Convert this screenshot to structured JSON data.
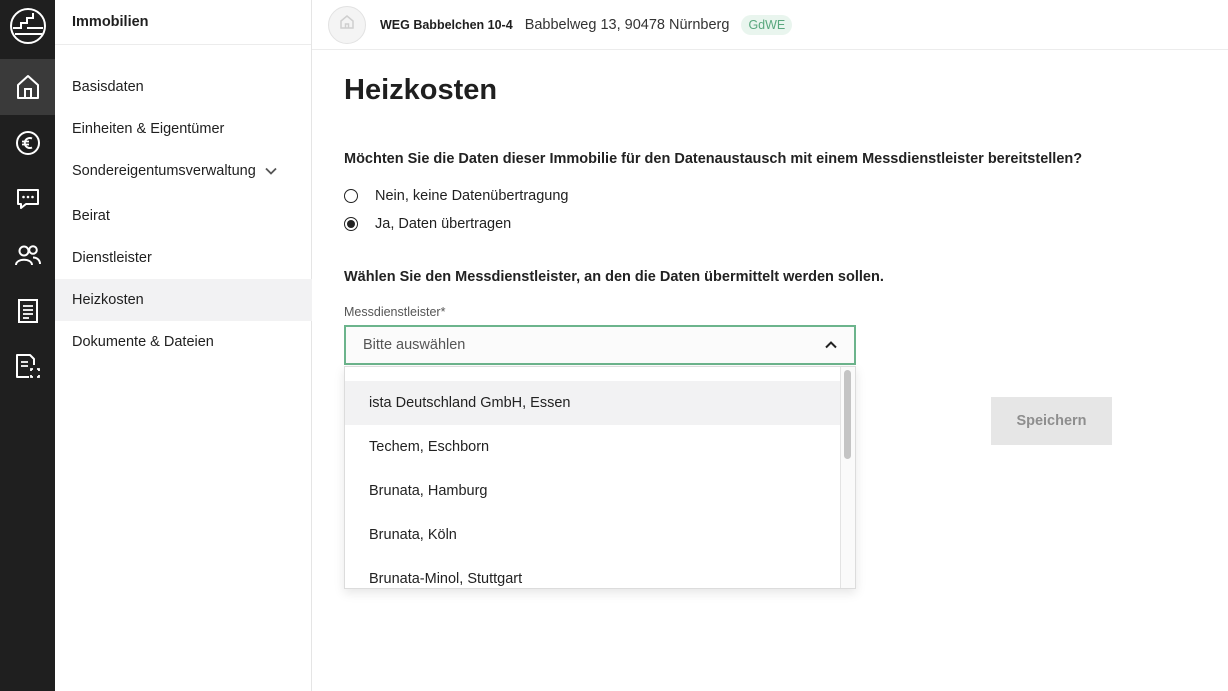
{
  "rail": {
    "items": [
      {
        "icon": "home-icon",
        "active": true
      },
      {
        "icon": "euro-icon",
        "active": false
      },
      {
        "icon": "chat-icon",
        "active": false
      },
      {
        "icon": "users-icon",
        "active": false
      },
      {
        "icon": "document-list-icon",
        "active": false
      },
      {
        "icon": "document-scan-icon",
        "active": false
      }
    ]
  },
  "sidebar": {
    "heading": "Immobilien",
    "items": [
      {
        "label": "Basisdaten"
      },
      {
        "label": "Einheiten & Eigentümer"
      },
      {
        "label": "Sondereigentumsverwaltung",
        "expandable": true
      },
      {
        "label": "Beirat"
      },
      {
        "label": "Dienstleister"
      },
      {
        "label": "Heizkosten",
        "active": true
      },
      {
        "label": "Dokumente & Dateien"
      }
    ]
  },
  "topbar": {
    "property_name": "WEG Babbelchen 10-4",
    "address": "Babbelweg 13, 90478 Nürnberg",
    "badge": "GdWE"
  },
  "main": {
    "title": "Heizkosten",
    "question": "Möchten Sie die Daten dieser Immobilie für den Datenaustausch mit einem Messdienstleister bereitstellen?",
    "radio_options": [
      {
        "label": "Nein, keine Datenübertragung",
        "selected": false
      },
      {
        "label": "Ja, Daten übertragen",
        "selected": true
      }
    ],
    "select_prompt": "Wählen Sie den Messdienstleister, an den die Daten übermittelt werden sollen.",
    "field_label": "Messdienstleister*",
    "select_placeholder": "Bitte auswählen",
    "dropdown_options": [
      "ista Deutschland GmbH, Essen",
      "Techem, Eschborn",
      "Brunata, Hamburg",
      "Brunata, Köln",
      "Brunata-Minol, Stuttgart"
    ],
    "save_label": "Speichern"
  },
  "colors": {
    "rail_bg": "#1f1f1f",
    "accent_green": "#6cb48c",
    "badge_bg": "#e9f5ee",
    "badge_text": "#5aa87e",
    "save_disabled_bg": "#e6e6e6"
  }
}
